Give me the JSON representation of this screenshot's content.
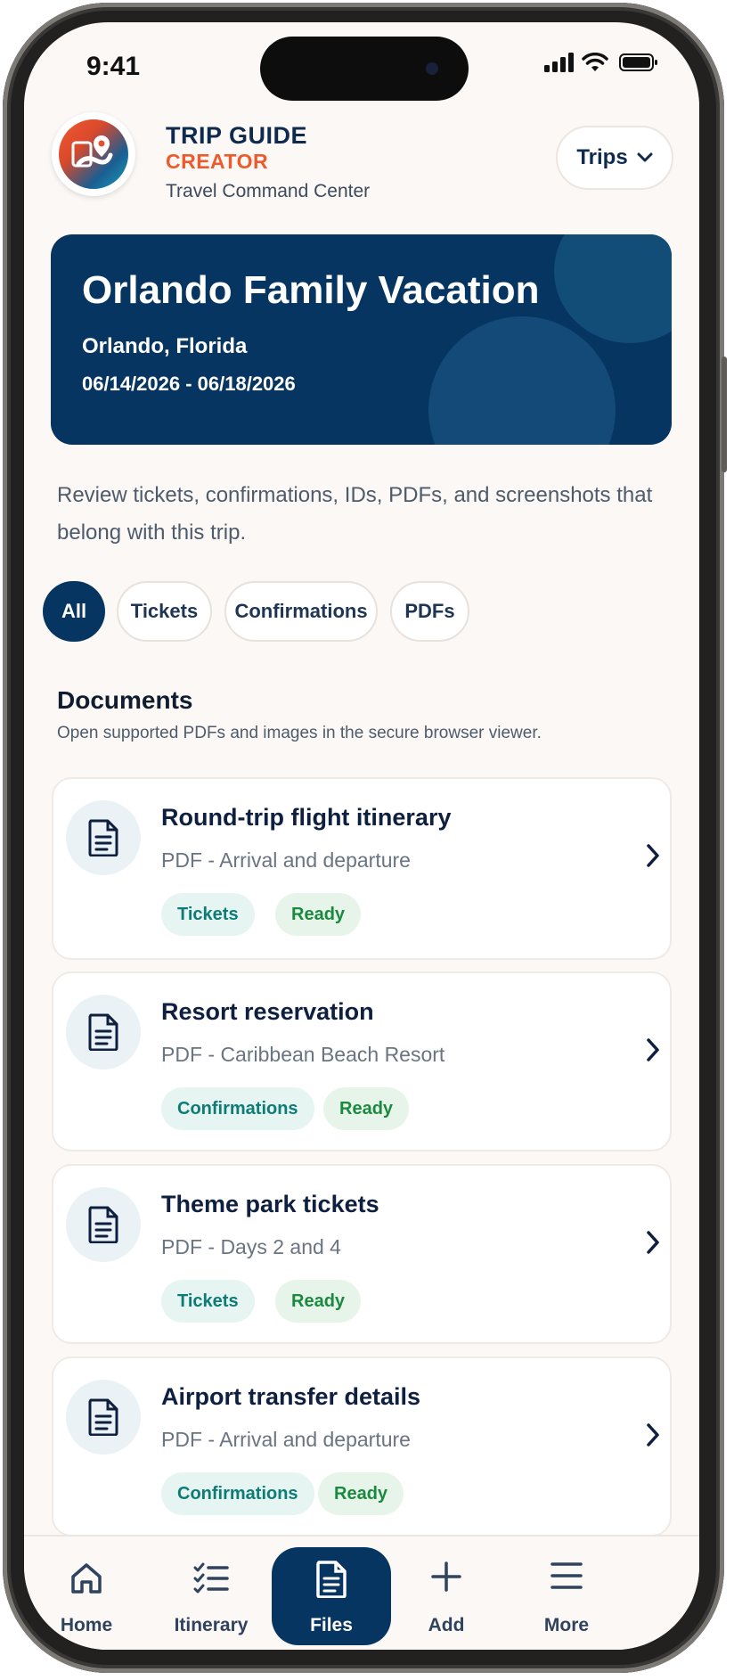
{
  "status_bar": {
    "time": "9:41"
  },
  "header": {
    "brand_line1": "TRIP GUIDE",
    "brand_line2": "CREATOR",
    "tagline": "Travel Command Center",
    "trips_button": "Trips"
  },
  "hero": {
    "title": "Orlando Family Vacation",
    "location": "Orlando, Florida",
    "dates": "06/14/2026 - 06/18/2026"
  },
  "intro": "Review tickets, confirmations, IDs, PDFs, and screenshots that belong with this trip.",
  "filters": [
    "All",
    "Tickets",
    "Confirmations",
    "PDFs"
  ],
  "filters_selected": "All",
  "documents": {
    "title": "Documents",
    "subtitle": "Open supported PDFs and images in the secure browser viewer.",
    "items": [
      {
        "title": "Round-trip flight itinerary",
        "subtitle": "PDF - Arrival and departure",
        "category": "Tickets",
        "status": "Ready"
      },
      {
        "title": "Resort reservation",
        "subtitle": "PDF - Caribbean Beach Resort",
        "category": "Confirmations",
        "status": "Ready"
      },
      {
        "title": "Theme park tickets",
        "subtitle": "PDF - Days 2 and 4",
        "category": "Tickets",
        "status": "Ready"
      },
      {
        "title": "Airport transfer details",
        "subtitle": "PDF - Arrival and departure",
        "category": "Confirmations",
        "status": "Ready"
      }
    ]
  },
  "bottom_nav": {
    "items": [
      {
        "label": "Home",
        "icon": "home-icon"
      },
      {
        "label": "Itinerary",
        "icon": "checklist-icon"
      },
      {
        "label": "Files",
        "icon": "document-icon"
      },
      {
        "label": "Add",
        "icon": "plus-icon"
      },
      {
        "label": "More",
        "icon": "menu-icon"
      }
    ],
    "active": "Files"
  },
  "colors": {
    "navy": "#063561",
    "brand_orange": "#ef5a2c",
    "teal_tag": "#0d7b76",
    "green_tag": "#1b8a40"
  }
}
